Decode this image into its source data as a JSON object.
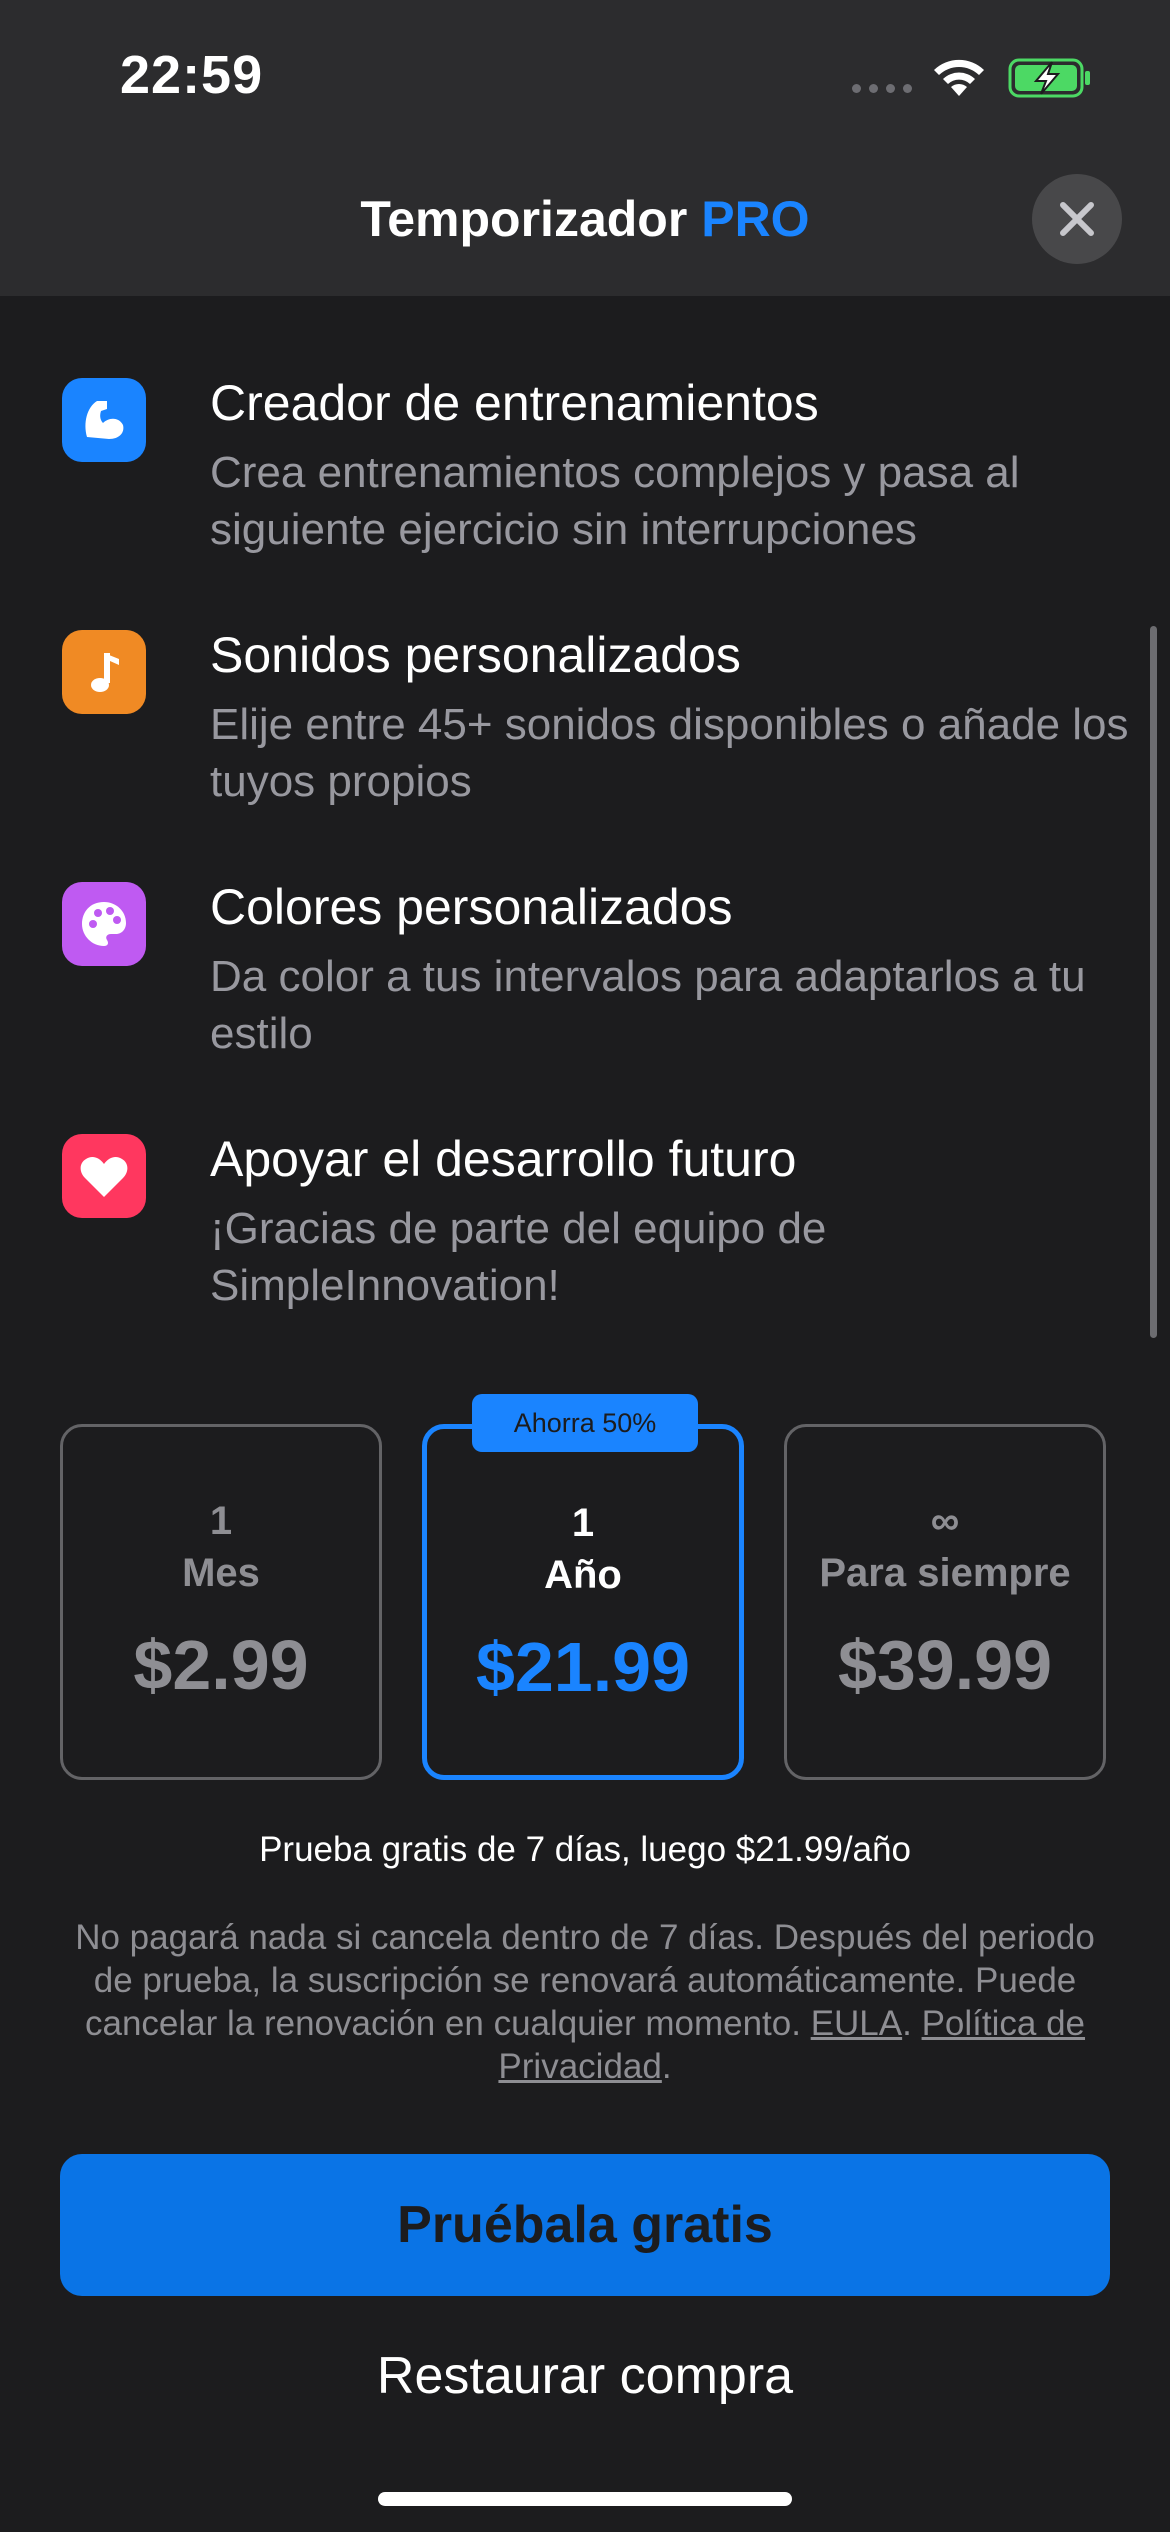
{
  "status_bar": {
    "time": "22:59",
    "battery_color": "#4cd964"
  },
  "nav": {
    "title": "Temporizador",
    "title_accent": "PRO",
    "close_icon": "close-icon"
  },
  "features": [
    {
      "icon": "flexed-biceps-icon",
      "icon_color": "#1a84ff",
      "title": "Creador de entrenamientos",
      "description": "Crea entrenamientos complejos y pasa al siguiente ejercicio sin interrupciones"
    },
    {
      "icon": "music-note-icon",
      "icon_color": "#f08a24",
      "title": "Sonidos personalizados",
      "description": "Elije entre 45+ sonidos disponibles o añade los tuyos propios"
    },
    {
      "icon": "palette-icon",
      "icon_color": "#bf5af2",
      "title": "Colores personalizados",
      "description": "Da color a tus intervalos para adaptarlos a tu estilo"
    },
    {
      "icon": "heart-icon",
      "icon_color": "#ff375f",
      "title": "Apoyar el desarrollo futuro",
      "description": "¡Gracias de parte del equipo de SimpleInnovation!"
    }
  ],
  "plans": [
    {
      "count": "1",
      "unit": "Mes",
      "price": "$2.99",
      "selected": false
    },
    {
      "count": "1",
      "unit": "Año",
      "price": "$21.99",
      "selected": true,
      "badge": "Ahorra 50%"
    },
    {
      "count": "∞",
      "unit": "Para siempre",
      "price": "$39.99",
      "selected": false
    }
  ],
  "trial_text": "Prueba gratis de 7 días, luego $21.99/año",
  "legal": {
    "text": "No pagará nada si cancela dentro de 7 días. Después del periodo de prueba, la suscripción se renovará automáticamente. Puede cancelar la renovación en cualquier momento.",
    "eula_label": "EULA",
    "privacy_label": "Política de Privacidad"
  },
  "cta_label": "Pruébala gratis",
  "restore_label": "Restaurar compra",
  "colors": {
    "accent": "#1a84ff",
    "background": "#1c1c1e",
    "secondary_text": "#98989f"
  }
}
